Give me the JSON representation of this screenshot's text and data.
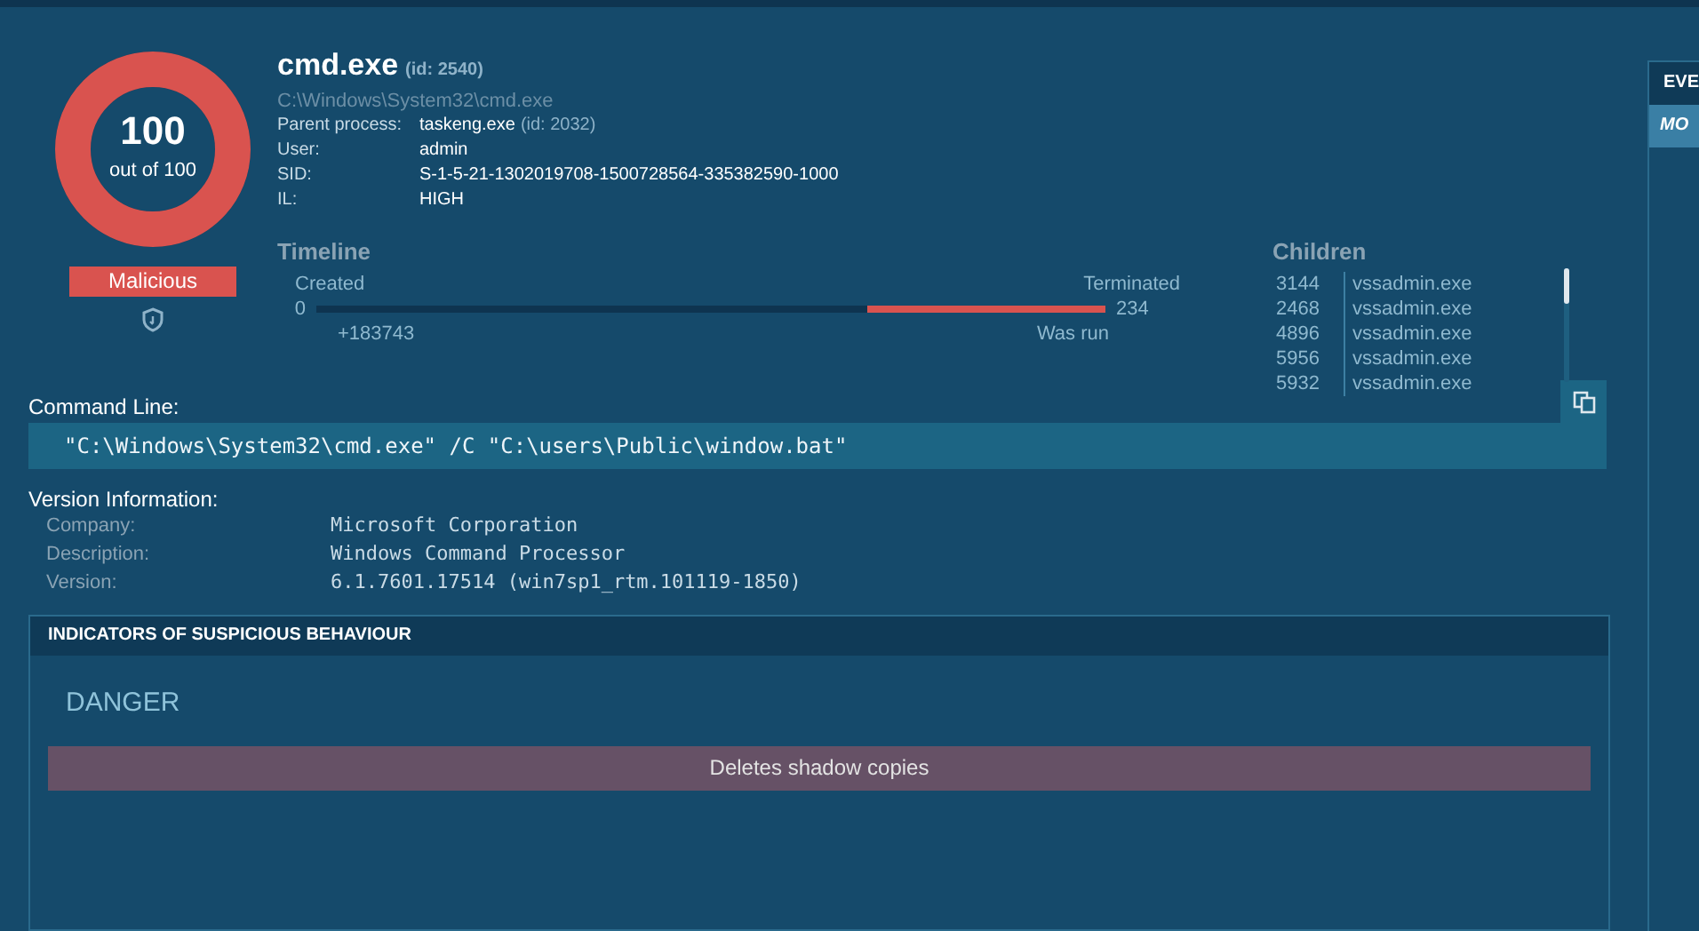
{
  "score": {
    "value": "100",
    "caption": "out of 100",
    "level": 1,
    "verdict": "Malicious"
  },
  "process": {
    "name": "cmd.exe",
    "id": "(id: 2540)",
    "path": "C:\\Windows\\System32\\cmd.exe",
    "fields": [
      {
        "label": "Parent process:",
        "value": "taskeng.exe",
        "extra": "(id: 2032)"
      },
      {
        "label": "User:",
        "value": "admin"
      },
      {
        "label": "SID:",
        "value": "S-1-5-21-1302019708-1500728564-335382590-1000"
      },
      {
        "label": "IL:",
        "value": "HIGH"
      }
    ]
  },
  "timeline": {
    "title": "Timeline",
    "start_label": "Created",
    "start_value": "0",
    "offset": "+183743",
    "end_label": "Terminated",
    "end_value": "234",
    "run_label": "Was run"
  },
  "children": {
    "title": "Children",
    "items": [
      {
        "pid": "3144",
        "name": "vssadmin.exe"
      },
      {
        "pid": "2468",
        "name": "vssadmin.exe"
      },
      {
        "pid": "4896",
        "name": "vssadmin.exe"
      },
      {
        "pid": "5956",
        "name": "vssadmin.exe"
      },
      {
        "pid": "5932",
        "name": "vssadmin.exe"
      }
    ]
  },
  "command_line": {
    "title": "Command Line:",
    "value": "\"C:\\Windows\\System32\\cmd.exe\" /C \"C:\\users\\Public\\window.bat\""
  },
  "version_info": {
    "title": "Version Information:",
    "rows": [
      {
        "label": "Company:",
        "value": "Microsoft Corporation"
      },
      {
        "label": "Description:",
        "value": "Windows Command Processor"
      },
      {
        "label": "Version:",
        "value": "6.1.7601.17514 (win7sp1_rtm.101119-1850)"
      }
    ]
  },
  "indicators": {
    "title": "INDICATORS OF SUSPICIOUS BEHAVIOUR",
    "groups": [
      {
        "level_name": "DANGER",
        "items": [
          "Deletes shadow copies"
        ]
      }
    ]
  },
  "side_panel": {
    "title": "EVE",
    "tab": "MO"
  }
}
